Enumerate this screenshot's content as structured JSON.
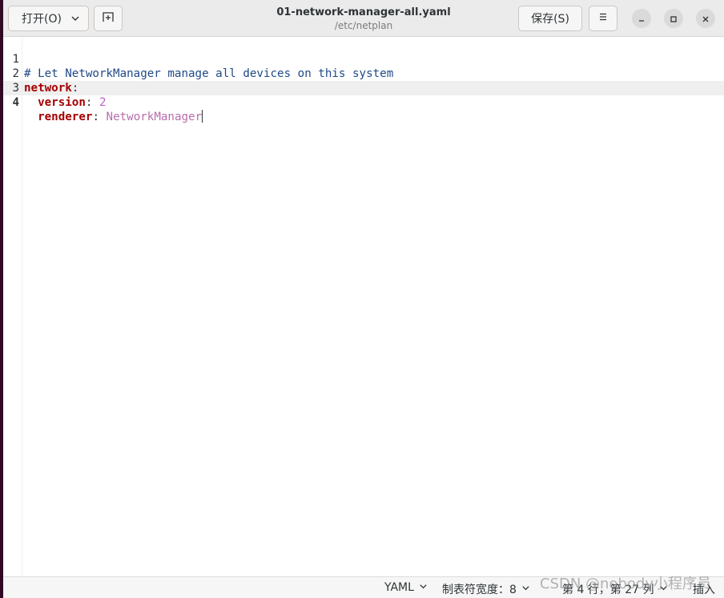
{
  "window": {
    "title": "01-network-manager-all.yaml",
    "subtitle": "/etc/netplan"
  },
  "header": {
    "open_label": "打开(O)",
    "save_label": "保存(S)"
  },
  "editor": {
    "lines": [
      {
        "number": "1",
        "comment": "# Let NetworkManager manage all devices on this system"
      },
      {
        "number": "2",
        "key": "network",
        "colon": ":"
      },
      {
        "number": "3",
        "indent": "  ",
        "key": "version",
        "colon": ":",
        "value": " 2"
      },
      {
        "number": "4",
        "indent": "  ",
        "key": "renderer",
        "colon": ":",
        "value": " NetworkManager"
      }
    ],
    "current_line": 4
  },
  "statusbar": {
    "language": "YAML",
    "tab_width": "制表符宽度：8",
    "cursor_position": "第 4 行，第 27 列",
    "insert_mode": "插入"
  },
  "watermark": "CSDN @nobody小程序员",
  "colors": {
    "comment": "#204a87",
    "key": "#a40000",
    "value": "#b86dab",
    "current_line": "#efefef"
  }
}
